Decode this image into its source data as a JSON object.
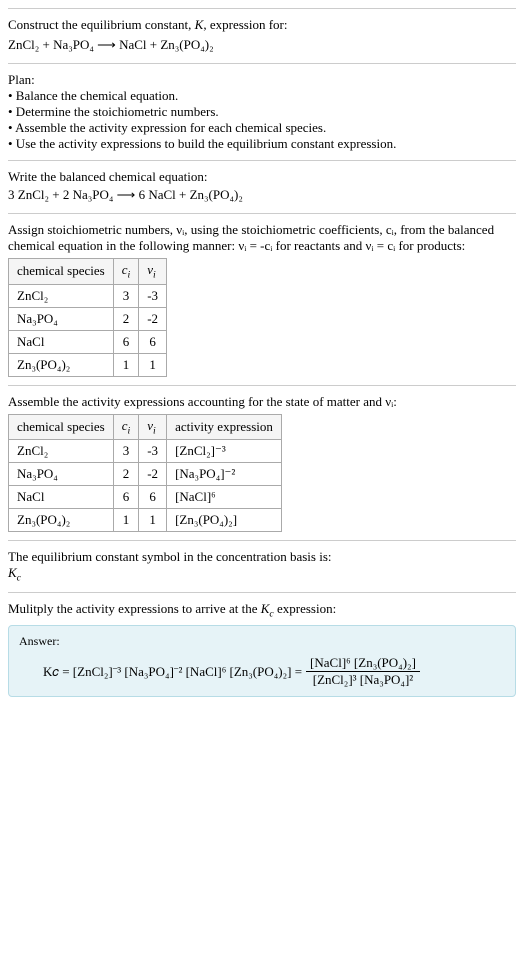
{
  "header": {
    "prompt": "Construct the equilibrium constant, K, expression for:",
    "equation": "ZnCl₂ + Na₃PO₄ ⟶ NaCl + Zn₃(PO₄)₂"
  },
  "plan": {
    "title": "Plan:",
    "b1": "• Balance the chemical equation.",
    "b2": "• Determine the stoichiometric numbers.",
    "b3": "• Assemble the activity expression for each chemical species.",
    "b4": "• Use the activity expressions to build the equilibrium constant expression."
  },
  "balanced": {
    "title": "Write the balanced chemical equation:",
    "equation": "3 ZnCl₂ + 2 Na₃PO₄ ⟶ 6 NaCl + Zn₃(PO₄)₂"
  },
  "stoich": {
    "intro1": "Assign stoichiometric numbers, νᵢ, using the stoichiometric coefficients, cᵢ, from the balanced chemical equation in the following manner: νᵢ = -cᵢ for reactants and νᵢ = cᵢ for products:",
    "hdr_species": "chemical species",
    "hdr_ci": "cᵢ",
    "hdr_vi": "νᵢ",
    "rows": [
      {
        "sp": "ZnCl₂",
        "ci": "3",
        "vi": "-3"
      },
      {
        "sp": "Na₃PO₄",
        "ci": "2",
        "vi": "-2"
      },
      {
        "sp": "NaCl",
        "ci": "6",
        "vi": "6"
      },
      {
        "sp": "Zn₃(PO₄)₂",
        "ci": "1",
        "vi": "1"
      }
    ]
  },
  "activity": {
    "intro": "Assemble the activity expressions accounting for the state of matter and νᵢ:",
    "hdr_species": "chemical species",
    "hdr_ci": "cᵢ",
    "hdr_vi": "νᵢ",
    "hdr_act": "activity expression",
    "rows": [
      {
        "sp": "ZnCl₂",
        "ci": "3",
        "vi": "-3",
        "act": "[ZnCl₂]⁻³"
      },
      {
        "sp": "Na₃PO₄",
        "ci": "2",
        "vi": "-2",
        "act": "[Na₃PO₄]⁻²"
      },
      {
        "sp": "NaCl",
        "ci": "6",
        "vi": "6",
        "act": "[NaCl]⁶"
      },
      {
        "sp": "Zn₃(PO₄)₂",
        "ci": "1",
        "vi": "1",
        "act": "[Zn₃(PO₄)₂]"
      }
    ]
  },
  "kc_symbol": {
    "line1": "The equilibrium constant symbol in the concentration basis is:",
    "line2": "K𝑐"
  },
  "multiply": {
    "intro": "Mulitply the activity expressions to arrive at the K𝑐 expression:"
  },
  "answer": {
    "label": "Answer:",
    "lhs": "K𝑐 = [ZnCl₂]⁻³ [Na₃PO₄]⁻² [NaCl]⁶ [Zn₃(PO₄)₂] =",
    "frac_num": "[NaCl]⁶ [Zn₃(PO₄)₂]",
    "frac_den": "[ZnCl₂]³ [Na₃PO₄]²"
  }
}
